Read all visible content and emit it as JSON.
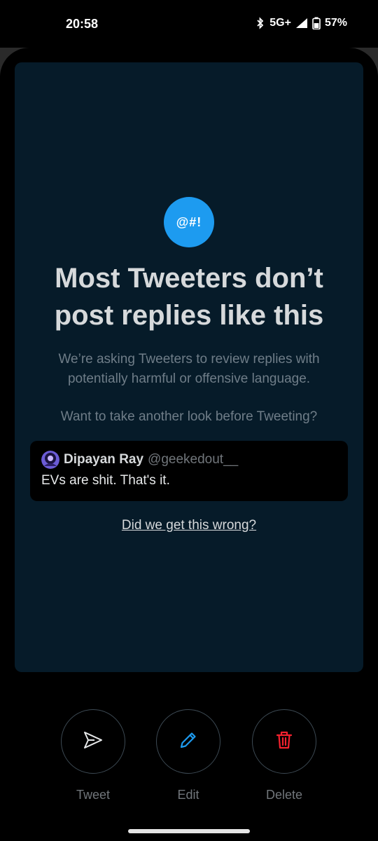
{
  "status_bar": {
    "time": "20:58",
    "network": "5G+",
    "battery": "57%"
  },
  "card": {
    "badge_text": "@#!",
    "headline": "Most Tweeters don’t post replies like this",
    "body": "We’re asking Tweeters to review replies with potentially harmful or offensive language.",
    "question": "Want to take another look before Tweeting?",
    "quote": {
      "name": "Dipayan Ray",
      "handle": "@geekedout__",
      "text": "EVs are shit. That's it."
    },
    "wrong_link": "Did we get this wrong?"
  },
  "actions": {
    "tweet_label": "Tweet",
    "edit_label": "Edit",
    "delete_label": "Delete"
  },
  "colors": {
    "accent": "#1d9bf0",
    "card_bg": "#061b29",
    "delete": "#f4212e"
  }
}
